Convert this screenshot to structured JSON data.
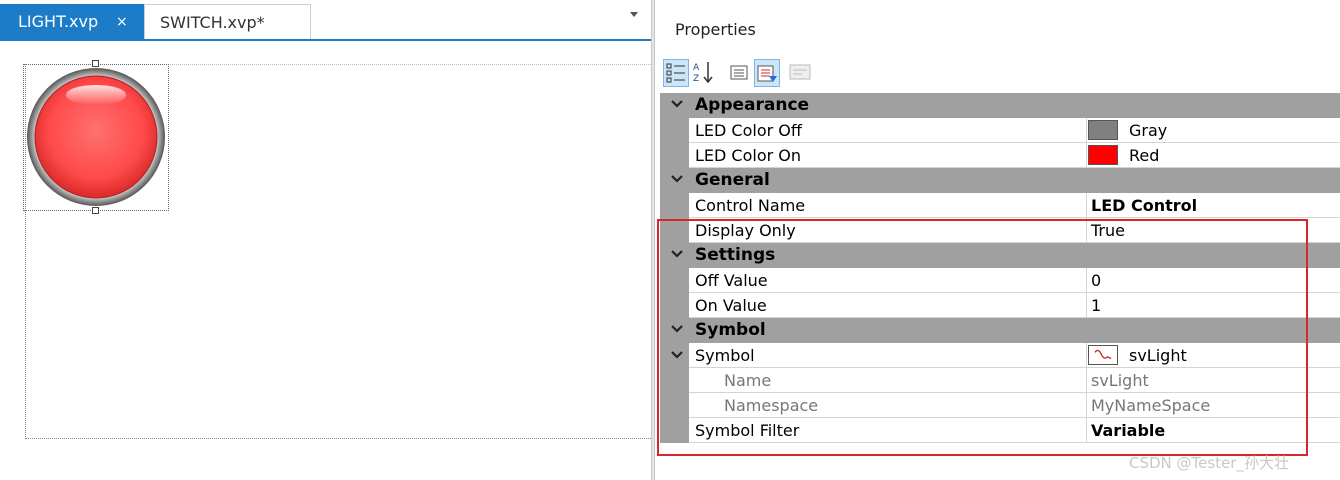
{
  "editor": {
    "tabs": [
      {
        "label": "LIGHT.xvp",
        "close": "×"
      },
      {
        "label": "SWITCH.xvp*"
      }
    ]
  },
  "properties": {
    "title": "Properties",
    "toolbar_icons": [
      "categorized-icon",
      "alphabetical-icon",
      "property-pages-icon",
      "events-icon",
      "disabled-icon"
    ],
    "categories": [
      {
        "label": "Appearance",
        "rows": [
          {
            "name": "LED Color Off",
            "value": "Gray",
            "color": "#808080"
          },
          {
            "name": "LED Color On",
            "value": "Red",
            "color": "#ff0000"
          }
        ]
      },
      {
        "label": "General",
        "rows": [
          {
            "name": "Control Name",
            "value": "LED Control"
          },
          {
            "name": "Display Only",
            "value": "True"
          }
        ]
      },
      {
        "label": "Settings",
        "rows": [
          {
            "name": "Off Value",
            "value": "0"
          },
          {
            "name": "On Value",
            "value": "1"
          }
        ]
      },
      {
        "label": "Symbol",
        "rows": [
          {
            "name": "Symbol",
            "value": "svLight"
          },
          {
            "name": "Name",
            "value": "svLight"
          },
          {
            "name": "Namespace",
            "value": "MyNameSpace"
          },
          {
            "name": "Symbol Filter",
            "value": "Variable"
          }
        ]
      }
    ]
  },
  "watermark": "CSDN @Tester_孙大壮",
  "colors": {
    "accent": "#1c7cc8",
    "highlight": "#d9252c",
    "category": "#a0a0a0"
  }
}
